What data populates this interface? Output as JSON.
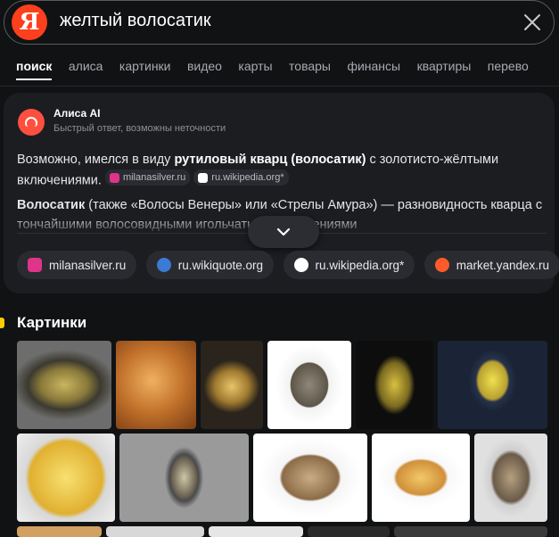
{
  "search": {
    "query": "желтый волосатик",
    "logo": "Я"
  },
  "tabs": [
    "поиск",
    "алиса",
    "картинки",
    "видео",
    "карты",
    "товары",
    "финансы",
    "квартиры",
    "перево"
  ],
  "alice": {
    "name": "Алиса AI",
    "subtitle": "Быстрый ответ, возможны неточности",
    "answer_pre": "Возможно, имелся в виду ",
    "answer_bold": "рутиловый кварц (волосатик)",
    "answer_post": " с золотисто-жёлтыми включениями.",
    "chip_1": "milanasilver.ru",
    "chip_2": "ru.wikipedia.org*",
    "para2_bold": "Волосатик",
    "para2_rest": " (также «Волосы Венеры» или «Стрелы Амура») — разновидность кварца с тончайшими волосовидными игольчатыми включениями"
  },
  "sources": [
    {
      "label": "milanasilver.ru",
      "icon": "milanasilver-icon",
      "color": "#e0338a"
    },
    {
      "label": "ru.wikiquote.org",
      "icon": "wikiquote-icon",
      "color": "#3a7bd5"
    },
    {
      "label": "ru.wikipedia.org*",
      "icon": "wikipedia-icon",
      "color": "#ffffff"
    },
    {
      "label": "market.yandex.ru",
      "icon": "market-icon",
      "color": "#ff5b2a"
    }
  ],
  "images": {
    "title": "Картинки"
  },
  "colors": {
    "accent": "#ffcc00",
    "brand": "#fc3f1d",
    "background": "#111214",
    "card": "#1c1d21"
  }
}
